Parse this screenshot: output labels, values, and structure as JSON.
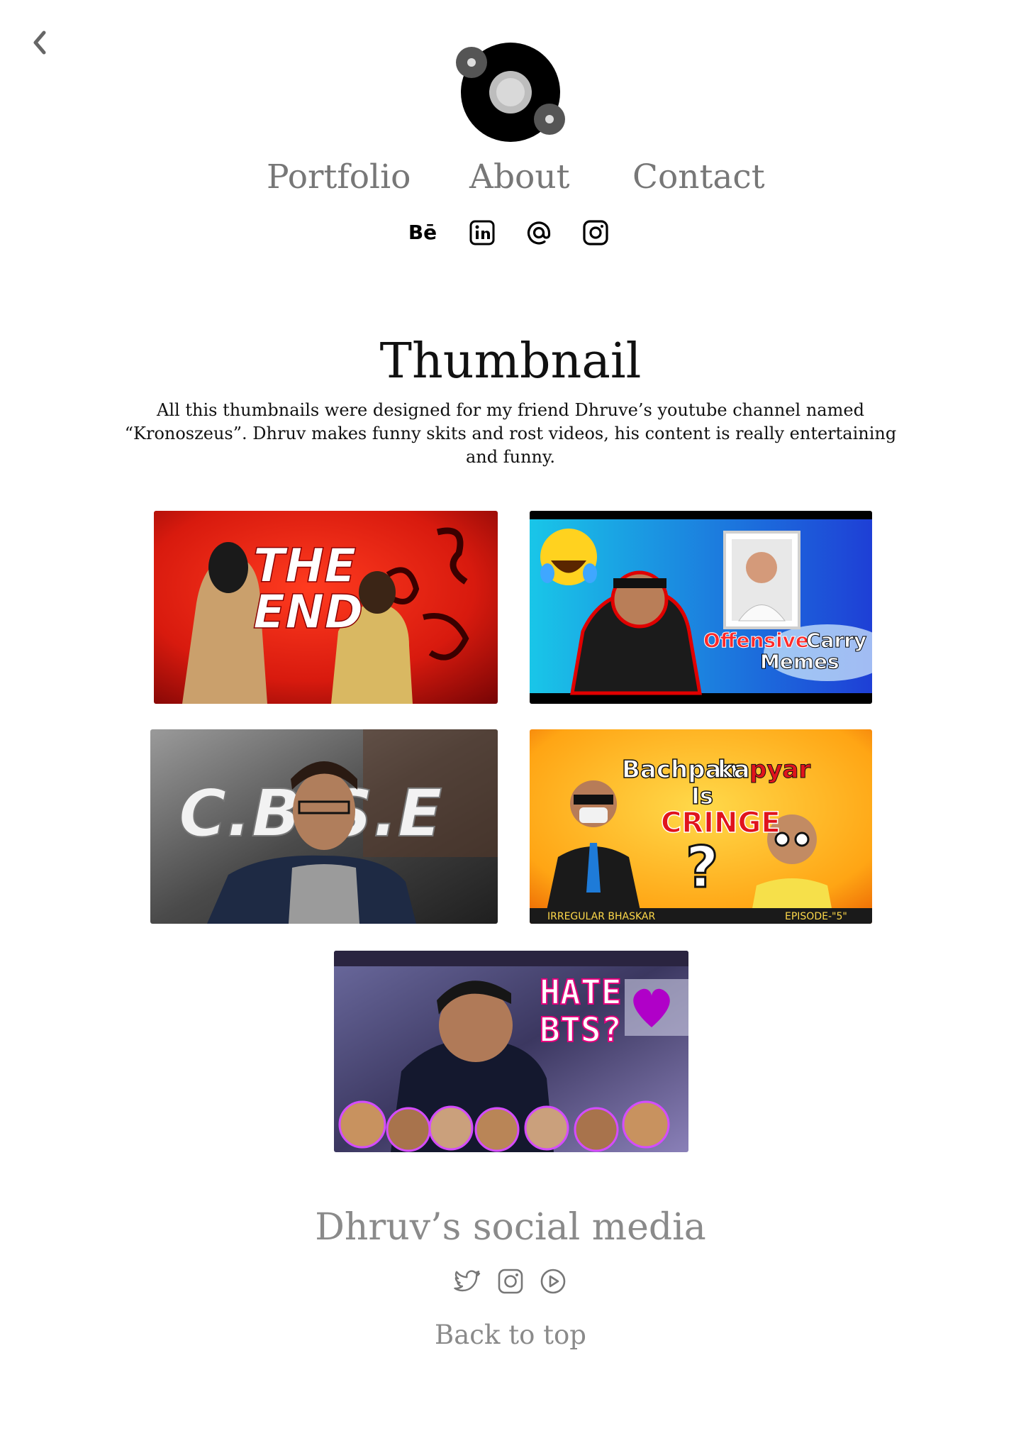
{
  "nav": {
    "back_icon": "chevron-left-icon",
    "logo_icon": "orbit-logo-icon",
    "links": [
      "Portfolio",
      "About",
      "Contact"
    ]
  },
  "social_top": {
    "behance_label": "Bē",
    "icons": [
      "behance-icon",
      "linkedin-icon",
      "email-at-icon",
      "instagram-icon"
    ]
  },
  "main": {
    "title": "Thumbnail",
    "description": "All this thumbnails were designed for my friend Dhruve’s youtube channel named “Kronoszeus”. Dhruv makes funny skits and rost videos, his content is really entertaining and funny."
  },
  "thumbnails": [
    {
      "text": [
        "THE",
        "END"
      ]
    },
    {
      "text": [
        "Offensive",
        "Carry",
        "Memes"
      ]
    },
    {
      "text": [
        "C.B.S.E"
      ]
    },
    {
      "text": [
        "Bachpan",
        "ka",
        "pyar",
        "Is",
        "CRINGE",
        "?",
        "IRREGULAR BHASKAR",
        "EPISODE-\"5\""
      ]
    },
    {
      "text": [
        "HATE",
        "BTS?"
      ]
    }
  ],
  "footer": {
    "title": "Dhruv’s social media",
    "icons": [
      "twitter-icon",
      "instagram-icon",
      "youtube-icon"
    ],
    "back_to_top": "Back to top"
  },
  "colors": {
    "background": "#ffffff",
    "nav_text": "#777777",
    "footer_text": "#8a8a8a"
  }
}
